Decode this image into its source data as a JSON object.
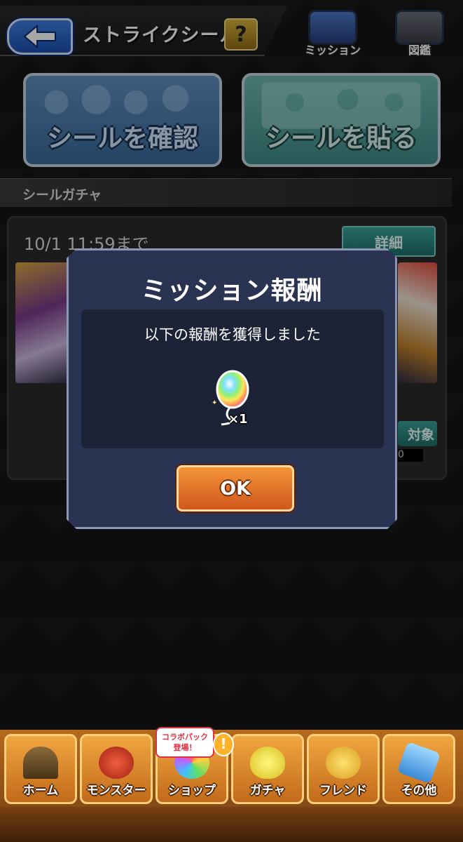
{
  "header": {
    "title": "ストライクシール",
    "help_label": "?"
  },
  "top_icons": {
    "mission_label": "ミッション",
    "encyclopedia_label": "図鑑"
  },
  "actions": {
    "check_stickers_label": "シールを確認",
    "paste_stickers_label": "シールを貼る"
  },
  "section": {
    "title": "シールガチャ"
  },
  "gacha": {
    "deadline": "10/1 11:59まで",
    "detail_label": "詳細",
    "target_label": "対象",
    "count_suffix": "0"
  },
  "modal": {
    "title": "ミッション報酬",
    "message": "以下の報酬を獲得しました",
    "reward_quantity": "×1",
    "ok_label": "OK"
  },
  "bottom_nav": {
    "items": [
      {
        "label": "ホーム"
      },
      {
        "label": "モンスター"
      },
      {
        "label": "ショップ"
      },
      {
        "label": "ガチャ"
      },
      {
        "label": "フレンド"
      },
      {
        "label": "その他"
      }
    ],
    "promo_badge_line1": "コラボパック",
    "promo_badge_line2": "登場！",
    "alert_badge": "!"
  },
  "colors": {
    "modal_bg": "#2b3352",
    "ok_button": "#e9772c",
    "back_button": "#2d66c8",
    "nav_bar": "#c87a2a"
  }
}
